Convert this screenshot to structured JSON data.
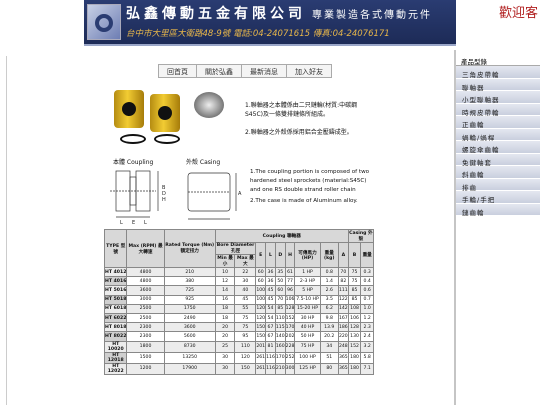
{
  "header": {
    "welcome": "歡迎客",
    "company": "弘鑫傳動五金有限公司",
    "slogan": "專業製造各式傳動元件",
    "address": "台中市大里區大衛路48-9號    電話:04-24071615  傳真:04-24076171"
  },
  "topnav": {
    "items": [
      "回首頁",
      "關於弘鑫",
      "最新消息",
      "加入好友"
    ]
  },
  "product": {
    "desc_zh": [
      "1.聯軸器之本體係由二只鏈輪(材質:中碳鋼 S45C)及一條雙排鏈條所組成。",
      "2.聯軸器之外殼係採用鋁合金壓鑄成型。"
    ],
    "label_coupling": "本體 Coupling",
    "label_casing": "外殼 Casing",
    "desc_en": [
      "1.The coupling portion is composed of two hardened steel sprockets (material:S45C) and one RS double strand roller chain",
      "2.The case is made of Aluminum alloy."
    ],
    "drawing_labels": [
      "B",
      "D",
      "H",
      "L",
      "E",
      "L",
      "A"
    ]
  },
  "spec_table": {
    "h_type": "TYPE 型號",
    "h_max": "Max (RPM) 最大轉速",
    "h_rated": "Rated Torque (Nm) 額定扭力",
    "h_coupling": "Coupling 聯軸器",
    "h_bore": "Bore Diameter 孔徑",
    "h_min": "Min 最小",
    "h_maxb": "Max 最大",
    "h_E": "E",
    "h_L": "L",
    "h_D": "D",
    "h_H": "H",
    "h_power": "可傳馬力 (HP)",
    "h_weight": "重量 (kg)",
    "h_casing": "Casing 外殼",
    "h_A": "A",
    "h_B": "B",
    "h_cw": "重量",
    "rows": [
      [
        "HT 4012",
        "4800",
        "210",
        "10",
        "22",
        "60",
        "36",
        "35",
        "61",
        "1 HP",
        "0.8",
        "70",
        "75",
        "0.3"
      ],
      [
        "HT 4016",
        "4800",
        "380",
        "12",
        "30",
        "60",
        "36",
        "50",
        "77",
        "2-3 HP",
        "1.4",
        "82",
        "75",
        "0.4"
      ],
      [
        "HT 5016",
        "3600",
        "725",
        "14",
        "40",
        "100",
        "45",
        "60",
        "96",
        "5 HP",
        "2.6",
        "111",
        "85",
        "0.6"
      ],
      [
        "HT 5018",
        "3000",
        "925",
        "16",
        "45",
        "100",
        "45",
        "70",
        "106",
        "7.5-10 HP",
        "3.5",
        "122",
        "85",
        "0.7"
      ],
      [
        "HT 6018",
        "2500",
        "1750",
        "18",
        "55",
        "120",
        "54",
        "85",
        "128",
        "15-20 HP",
        "6.2",
        "142",
        "108",
        "1.0"
      ],
      [
        "HT 6022",
        "2500",
        "2490",
        "18",
        "75",
        "120",
        "54",
        "110",
        "152",
        "30 HP",
        "9.8",
        "167",
        "106",
        "1.2"
      ],
      [
        "HT 8018",
        "2300",
        "3600",
        "20",
        "75",
        "150",
        "67",
        "115",
        "170",
        "40 HP",
        "13.9",
        "186",
        "128",
        "2.3"
      ],
      [
        "HT 8022",
        "2300",
        "5600",
        "20",
        "95",
        "150",
        "67",
        "140",
        "202",
        "50 HP",
        "20.2",
        "220",
        "130",
        "2.4"
      ],
      [
        "HT 10020",
        "1800",
        "8730",
        "25",
        "110",
        "201",
        "81",
        "160",
        "228",
        "75 HP",
        "34",
        "248",
        "152",
        "3.2"
      ],
      [
        "HT 12018",
        "1500",
        "13250",
        "30",
        "120",
        "261",
        "116",
        "170",
        "252",
        "100 HP",
        "51",
        "365",
        "180",
        "5.8"
      ],
      [
        "HT 12022",
        "1200",
        "17900",
        "30",
        "150",
        "261",
        "116",
        "210",
        "300",
        "125 HP",
        "80",
        "365",
        "180",
        "7.1"
      ]
    ]
  },
  "sidebar": {
    "heading": "產品型錄",
    "items": [
      "三角皮帶輪",
      "聯軸器",
      "小型聯軸器",
      "時規皮帶輪",
      "正齒輪",
      "蝸輪/蝸桿",
      "螺旋傘齒輪",
      "免鍵軸套",
      "斜齒輪",
      "排齒",
      "手輪/手把",
      "鏈齒輪"
    ]
  }
}
